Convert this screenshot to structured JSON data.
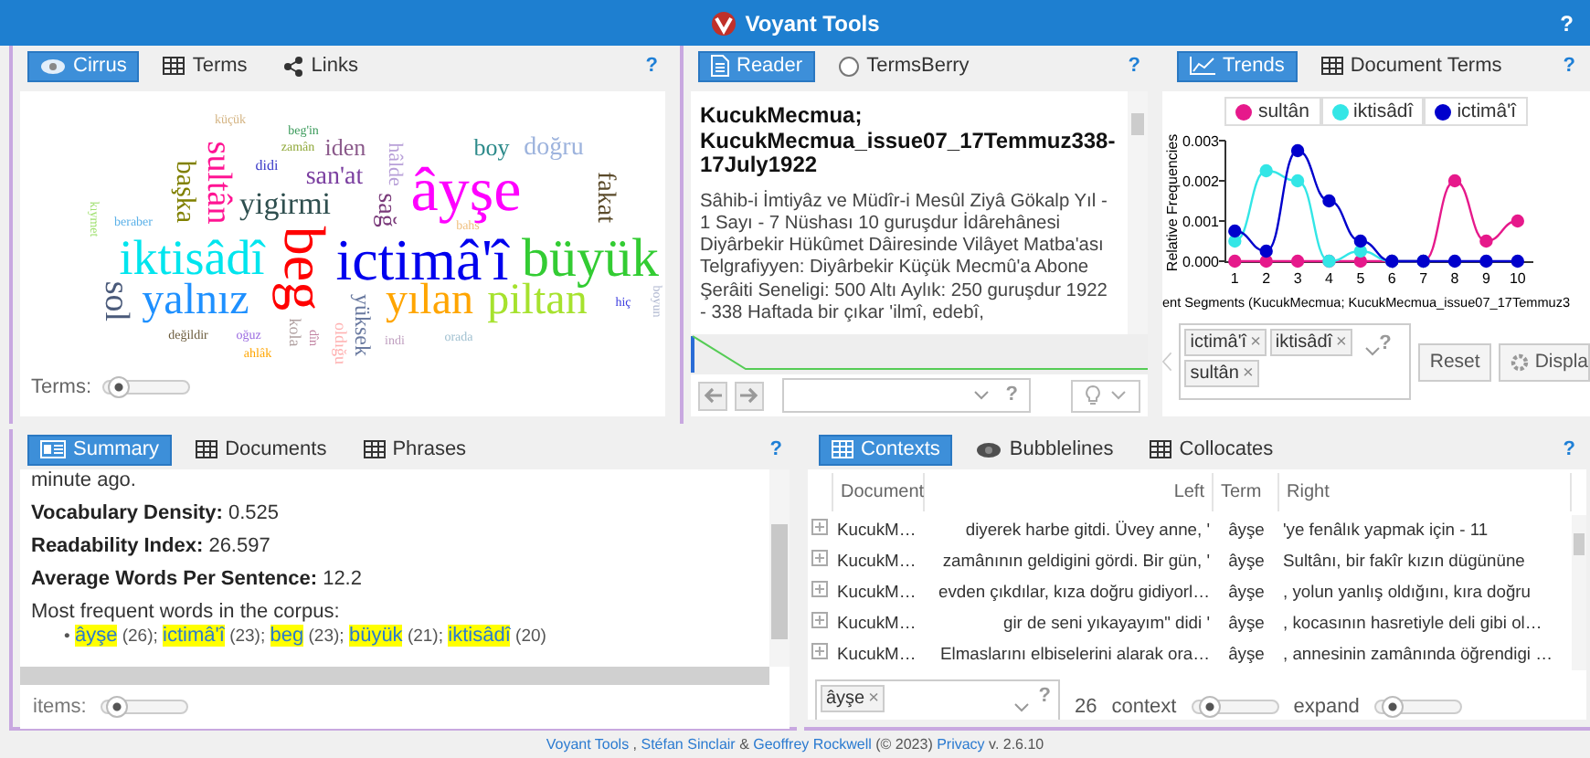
{
  "header": {
    "title": "Voyant Tools",
    "help": "?"
  },
  "cirrus": {
    "tabs": [
      {
        "label": "Cirrus",
        "selected": true
      },
      {
        "label": "Terms",
        "selected": false
      },
      {
        "label": "Links",
        "selected": false
      }
    ],
    "help": "?",
    "words": [
      {
        "text": "küçük",
        "color": "#d4b483"
      },
      {
        "text": "beg'in",
        "color": "#3a9a5a"
      },
      {
        "text": "zamân",
        "color": "#8fa838"
      },
      {
        "text": "iden",
        "color": "#8b5a8b"
      },
      {
        "text": "boy",
        "color": "#2e8b8b"
      },
      {
        "text": "doğru",
        "color": "#9db3dd"
      },
      {
        "text": "didi",
        "color": "#3a3ac8"
      },
      {
        "text": "hâlde",
        "color": "#b8a0d8"
      },
      {
        "text": "kıymet",
        "color": "#a0e070"
      },
      {
        "text": "beraber",
        "color": "#5ab0e8"
      },
      {
        "text": "başka",
        "color": "#808000"
      },
      {
        "text": "sultân",
        "color": "#ff1493"
      },
      {
        "text": "yigirmi",
        "color": "#2f4f4f"
      },
      {
        "text": "san'at",
        "color": "#7b3fa0"
      },
      {
        "text": "sağ",
        "color": "#7a3a7a"
      },
      {
        "text": "âyşe",
        "color": "#ff00ff"
      },
      {
        "text": "fakat",
        "color": "#5a4a2a"
      },
      {
        "text": "bahs",
        "color": "#f0c080"
      },
      {
        "text": "iktisâdî",
        "color": "#00e5ee"
      },
      {
        "text": "beg",
        "color": "#ff0000"
      },
      {
        "text": "ictimâ'î",
        "color": "#0000ee"
      },
      {
        "text": "büyük",
        "color": "#33cc33"
      },
      {
        "text": "sol",
        "color": "#4a5a7a"
      },
      {
        "text": "yalnız",
        "color": "#1e90ff"
      },
      {
        "text": "yüksek",
        "color": "#6a7aa0"
      },
      {
        "text": "yılan",
        "color": "#ffa500"
      },
      {
        "text": "piltan",
        "color": "#a6e22e"
      },
      {
        "text": "hiç",
        "color": "#4040e0"
      },
      {
        "text": "boyun",
        "color": "#b0b8d0"
      },
      {
        "text": "değildir",
        "color": "#6a5a3a"
      },
      {
        "text": "oğuz",
        "color": "#9a6ae0"
      },
      {
        "text": "ahlâk",
        "color": "#ffa500"
      },
      {
        "text": "kola",
        "color": "#b0a0a0"
      },
      {
        "text": "dîn",
        "color": "#c080a0"
      },
      {
        "text": "oldığu",
        "color": "#ffb0b0"
      },
      {
        "text": "indi",
        "color": "#c0a0c0"
      },
      {
        "text": "orada",
        "color": "#a0c0d0"
      }
    ],
    "terms_slider": {
      "label": "Terms:",
      "level": 0.05
    }
  },
  "reader": {
    "tabs": [
      {
        "label": "Reader",
        "selected": true
      },
      {
        "label": "TermsBerry",
        "selected": false
      }
    ],
    "help": "?",
    "title": "KucukMecmua; KucukMecmua_issue07_17Temmuz338-17July1922",
    "text": "Sâhib-i İmtiyâz ve Müdîr-i Mesûl Ziyâ Gökalp Yıl - 1 Sayı - 7 Nüshası 10 guruşdur İdârehânesi Diyârbekir Hükûmet Dâiresinde Vilâyet Matba'ası Telgrafiyyen: Diyârbekir Küçük Mecmû'a Abone Şerâiti Seneligi: 500 Altı Aylık: 250 guruşdur 1922 - 338 Haftada bir çıkar 'ilmî, edebî,",
    "toolbar_help": "?"
  },
  "trends": {
    "tabs": [
      {
        "label": "Trends",
        "selected": true
      },
      {
        "label": "Document Terms",
        "selected": false
      }
    ],
    "help": "?",
    "chart_data": {
      "type": "line",
      "ylabel": "Relative Frequencies",
      "xlabel": "ent Segments (KucukMecmua; KucukMecmua_issue07_17Temmuz3",
      "x": [
        1,
        2,
        3,
        4,
        5,
        6,
        7,
        8,
        9,
        10
      ],
      "xlim": [
        0.7,
        10.5
      ],
      "ylim": [
        0,
        0.003
      ],
      "yticks": [
        {
          "value": 0,
          "label": "0.000"
        },
        {
          "value": 0.001,
          "label": "0.001"
        },
        {
          "value": 0.002,
          "label": "0.002"
        },
        {
          "value": 0.003,
          "label": "0.003"
        }
      ],
      "xticks": [
        1,
        2,
        3,
        4,
        5,
        6,
        7,
        8,
        9,
        10
      ],
      "series": [
        {
          "name": "sultân",
          "color": "#e6198b",
          "marker": "circle",
          "values": [
            0,
            0,
            0,
            0,
            0,
            0,
            0,
            0.002,
            0.0005,
            0.001
          ]
        },
        {
          "name": "iktisâdî",
          "color": "#33e6e6",
          "marker": "circle",
          "values": [
            0.0005,
            0.00225,
            0.002,
            0,
            0.00025,
            0,
            0,
            null,
            null,
            null
          ]
        },
        {
          "name": "ictimâ'î",
          "color": "#0000cc",
          "marker": "circle",
          "values": [
            0.00075,
            0.00025,
            0.00275,
            0.0015,
            0.0005,
            0,
            0,
            0,
            0,
            0
          ]
        }
      ]
    },
    "query_terms": [
      {
        "text": "ictimâ'î",
        "remove": "×"
      },
      {
        "text": "iktisâdî",
        "remove": "×"
      },
      {
        "text": "sultân",
        "remove": "×"
      }
    ],
    "query_help": "?",
    "buttons": [
      "Reset",
      "Displa"
    ]
  },
  "summary": {
    "tabs": [
      {
        "label": "Summary",
        "selected": true
      },
      {
        "label": "Documents",
        "selected": false
      },
      {
        "label": "Phrases",
        "selected": false
      }
    ],
    "help": "?",
    "cut_line": "minute ago.",
    "stats": [
      "**Vocabulary Density:** 0.525",
      "**Readability Index:** 26.597",
      "**Average Words Per Sentence:** 12.2"
    ],
    "frequent_label": "Most frequent words in the corpus:",
    "bullet": "•",
    "frequent_words": [
      {
        "word": "âyşe",
        "count": "(26);"
      },
      {
        "word": "ictimâ'î",
        "count": "(23);"
      },
      {
        "word": "beg",
        "count": "(23);"
      },
      {
        "word": "büyük",
        "count": "(21);"
      },
      {
        "word": "iktisâdî",
        "count": "(20)"
      }
    ],
    "items_slider": {
      "label": "items:",
      "level": 0.05
    }
  },
  "contexts": {
    "tabs": [
      {
        "label": "Contexts",
        "selected": true
      },
      {
        "label": "Bubblelines",
        "selected": false
      },
      {
        "label": "Collocates",
        "selected": false
      }
    ],
    "help": "?",
    "table": {
      "columns": [
        "Document",
        "Left",
        "Term",
        "Right"
      ],
      "rows": [
        {
          "cells": [
            "KucukM…",
            "diyerek harbe gitdi. Üvey anne, '",
            "âyşe",
            "'ye fenâlık yapmak için - 11"
          ]
        },
        {
          "cells": [
            "KucukM…",
            "zamânının geldigini gördi. Bir gün, '",
            "âyşe",
            "Sultânı, bir fakîr kızın dügününe"
          ]
        },
        {
          "cells": [
            "KucukM…",
            "evden çıkdılar, kıza doğru gidiyorl…",
            "âyşe",
            ", yolun yanlış oldığını, kıra doğru"
          ]
        },
        {
          "cells": [
            "KucukM…",
            "gir de seni yıkayayım\" didi '",
            "âyşe",
            ", kocasının hasretiyle deli gibi ol…"
          ]
        },
        {
          "cells": [
            "KucukM…",
            "Elmaslarını elbiselerini alarak ora…",
            "âyşe",
            ", annesinin zamânında öğrendigi …"
          ]
        }
      ]
    },
    "query_terms": [
      {
        "text": "âyşe",
        "remove": "×"
      }
    ],
    "query_help": "?",
    "count": "26",
    "sliders": [
      {
        "label": "context",
        "level": 0.1
      },
      {
        "label": "expand",
        "level": 0.1
      }
    ]
  },
  "footer": {
    "parts": [
      {
        "kind": "link",
        "text": "Voyant Tools"
      },
      {
        "kind": "text",
        "text": " , "
      },
      {
        "kind": "link",
        "text": "Stéfan Sinclair"
      },
      {
        "kind": "text",
        "text": " & "
      },
      {
        "kind": "link",
        "text": "Geoffrey Rockwell"
      },
      {
        "kind": "text",
        "text": " (© 2023) "
      },
      {
        "kind": "link",
        "text": "Privacy"
      },
      {
        "kind": "text",
        "text": " v. 2.6.10"
      }
    ]
  }
}
